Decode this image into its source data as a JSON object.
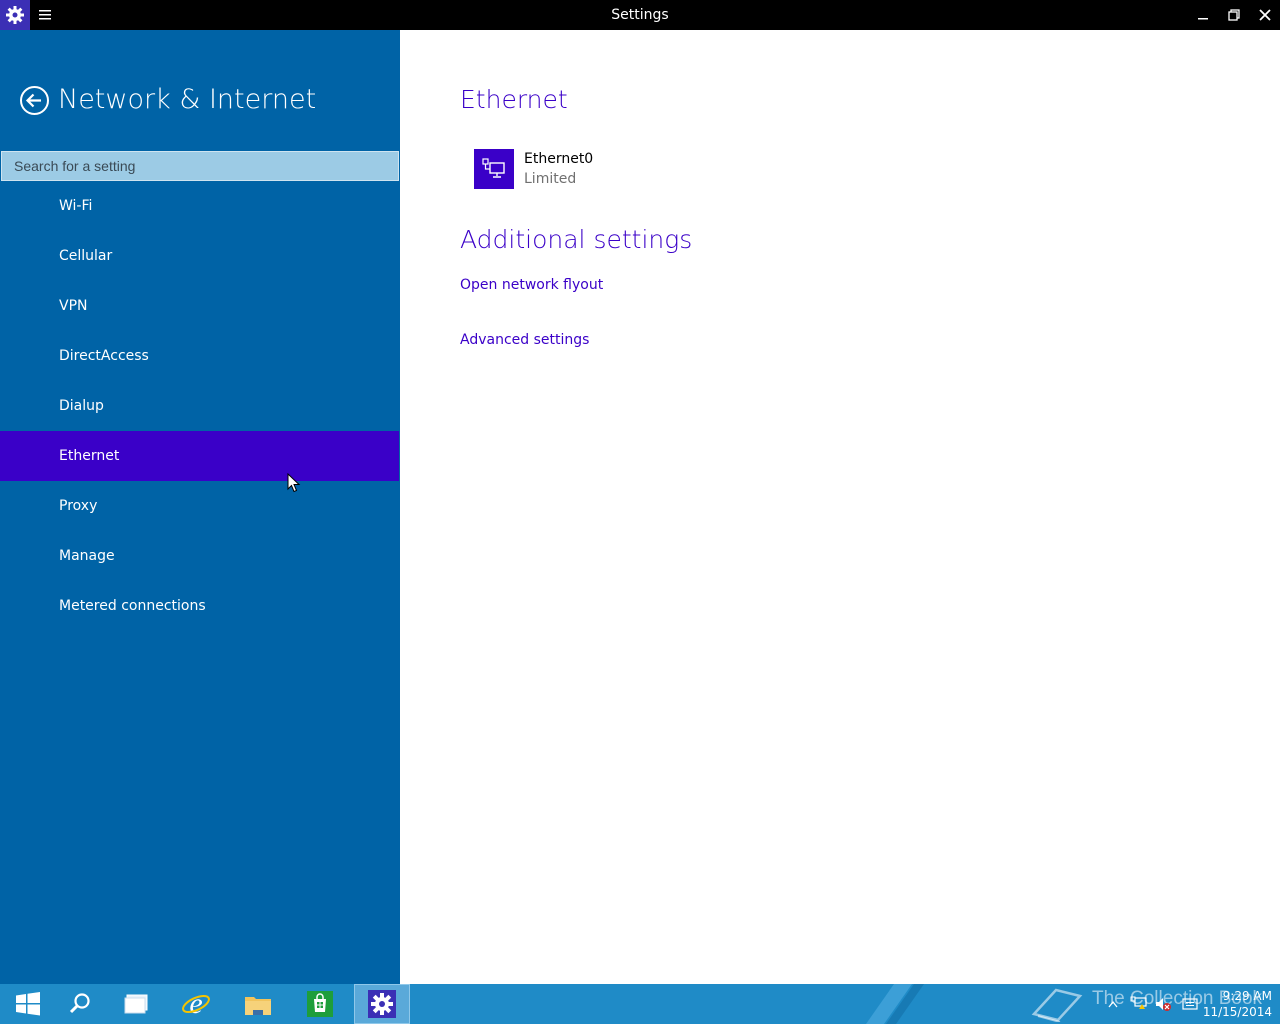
{
  "window": {
    "title": "Settings",
    "app_icon": "gear-icon",
    "menu_icon": "hamburger-icon",
    "controls": [
      "minimize-icon",
      "restore-icon",
      "close-icon"
    ]
  },
  "sidebar": {
    "back_icon": "back-arrow-icon",
    "title": "Network & Internet",
    "search_placeholder": "Search for a setting",
    "items": [
      {
        "label": "Wi-Fi",
        "active": false
      },
      {
        "label": "Cellular",
        "active": false
      },
      {
        "label": "VPN",
        "active": false
      },
      {
        "label": "DirectAccess",
        "active": false
      },
      {
        "label": "Dialup",
        "active": false
      },
      {
        "label": "Ethernet",
        "active": true
      },
      {
        "label": "Proxy",
        "active": false
      },
      {
        "label": "Manage",
        "active": false
      },
      {
        "label": "Metered connections",
        "active": false
      }
    ]
  },
  "main": {
    "section_title": "Ethernet",
    "connection": {
      "icon": "ethernet-icon",
      "name": "Ethernet0",
      "status": "Limited"
    },
    "additional_title": "Additional settings",
    "links": [
      {
        "label": "Open network flyout"
      },
      {
        "label": "Advanced settings"
      }
    ]
  },
  "taskbar": {
    "buttons": [
      "start-icon",
      "search-icon",
      "task-view-icon",
      "internet-explorer-icon",
      "file-explorer-icon",
      "store-icon",
      "settings-icon"
    ],
    "active_button": "settings-icon",
    "watermark": "The Collection Book",
    "tray_icons": [
      "show-hidden-icons-icon",
      "network-icon",
      "volume-icon",
      "action-center-icon"
    ],
    "time": "9:29 AM",
    "date": "11/15/2014"
  },
  "colors": {
    "sidebar_bg": "#0063a6",
    "accent": "#3a00c8",
    "taskbar_bg": "#1f8bc7",
    "titlebar_bg": "#000000"
  }
}
